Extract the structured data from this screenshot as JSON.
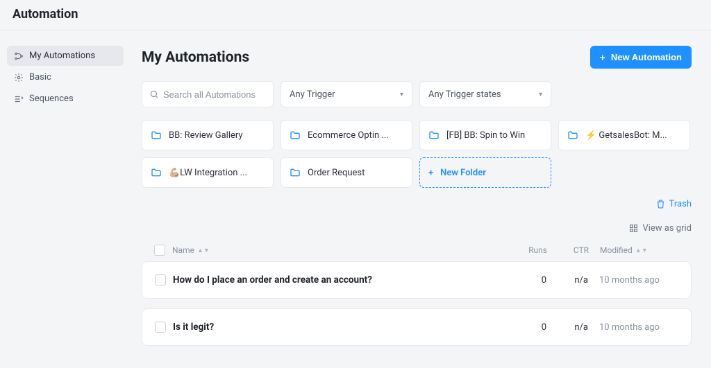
{
  "header": {
    "title": "Automation"
  },
  "sidebar": {
    "items": [
      {
        "label": "My Automations",
        "active": true
      },
      {
        "label": "Basic",
        "active": false
      },
      {
        "label": "Sequences",
        "active": false
      }
    ]
  },
  "main": {
    "title": "My Automations",
    "new_button": "New Automation",
    "search_placeholder": "Search all Automations",
    "filter_trigger": "Any Trigger",
    "filter_states": "Any Trigger states",
    "folders": [
      {
        "label": "BB: Review Gallery"
      },
      {
        "label": "Ecommerce Optin ..."
      },
      {
        "label": "[FB] BB: Spin to Win"
      },
      {
        "label": "⚡ GetsalesBot: M..."
      },
      {
        "label": "💪🏼LW Integration ..."
      },
      {
        "label": "Order Request"
      }
    ],
    "new_folder_label": "New Folder",
    "trash_label": "Trash",
    "viewgrid_label": "View as grid",
    "columns": {
      "name": "Name",
      "runs": "Runs",
      "ctr": "CTR",
      "modified": "Modified"
    },
    "rows": [
      {
        "name": "How do I place an order and create an account?",
        "runs": "0",
        "ctr": "n/a",
        "modified": "10 months ago"
      },
      {
        "name": "Is it legit?",
        "runs": "0",
        "ctr": "n/a",
        "modified": "10 months ago"
      }
    ]
  }
}
